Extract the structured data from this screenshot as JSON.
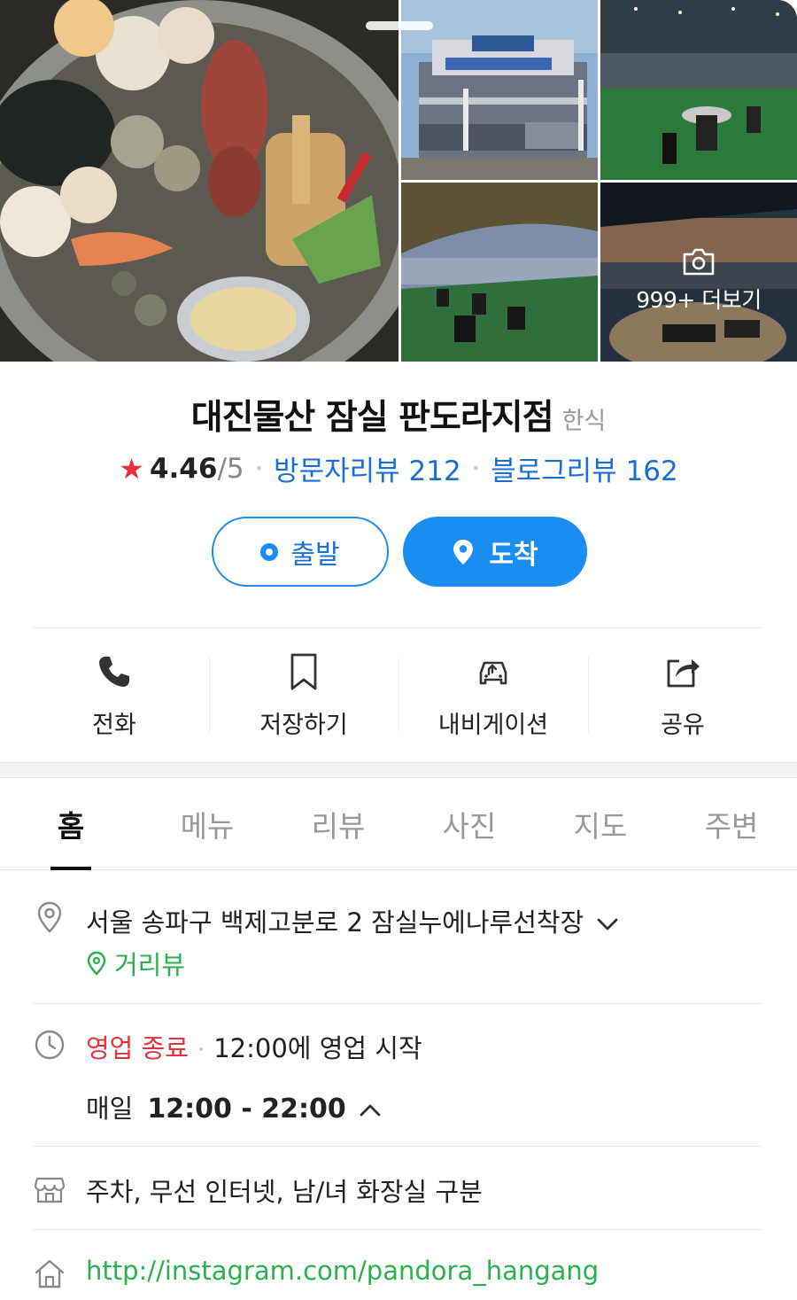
{
  "gallery": {
    "more_label": "999+ 더보기",
    "photos": [
      "seafood-platter-photo",
      "cruise-ship-exterior-photo",
      "deck-tables-photo",
      "deck-awning-photo",
      "sunset-grill-photo"
    ]
  },
  "place": {
    "name": "대진물산 잠실 판도라지점",
    "category": "한식",
    "rating": "4.46",
    "rating_max": "/5",
    "visitor_reviews": "방문자리뷰 212",
    "blog_reviews": "블로그리뷰 162"
  },
  "route": {
    "depart_label": "출발",
    "arrive_label": "도착"
  },
  "actions": [
    {
      "label": "전화",
      "icon": "phone-icon"
    },
    {
      "label": "저장하기",
      "icon": "bookmark-icon"
    },
    {
      "label": "내비게이션",
      "icon": "navigation-car-icon"
    },
    {
      "label": "공유",
      "icon": "share-icon"
    }
  ],
  "tabs": [
    {
      "label": "홈",
      "active": true
    },
    {
      "label": "메뉴"
    },
    {
      "label": "리뷰"
    },
    {
      "label": "사진"
    },
    {
      "label": "지도"
    },
    {
      "label": "주변"
    }
  ],
  "info": {
    "address": "서울 송파구 백제고분로 2 잠실누에나루선착장",
    "street_view": "거리뷰",
    "status": "영업 종료",
    "next_open": "12:00에 영업 시작",
    "hours_day": "매일",
    "hours_time": "12:00 - 22:00",
    "amenities": "주차, 무선 인터넷, 남/녀 화장실 구분",
    "website": "http://instagram.com/pandora_hangang"
  },
  "colors": {
    "accent_blue": "#1a8df0",
    "link_blue": "#1a6fd6",
    "closed_red": "#e5323e",
    "star_red": "#e5323e",
    "green": "#2bb24c"
  }
}
